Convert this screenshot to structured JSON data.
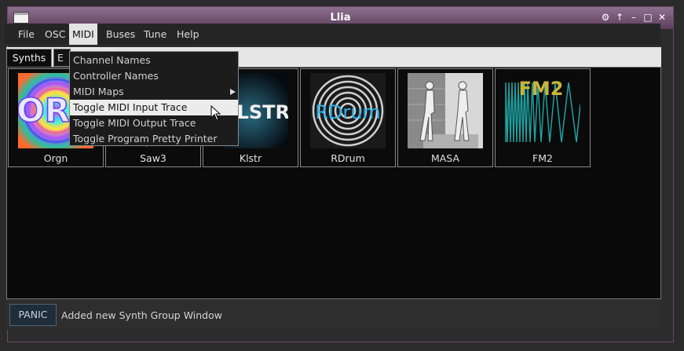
{
  "window": {
    "title": "Llia"
  },
  "menubar": {
    "items": [
      "File",
      "OSC",
      "MIDI",
      "Buses",
      "Tune",
      "Help"
    ]
  },
  "tabs": {
    "active": "Synths",
    "second_partial": "E"
  },
  "synths": [
    {
      "label": "Orgn",
      "logo_text": "ORG"
    },
    {
      "label": "Saw3"
    },
    {
      "label": "Klstr",
      "logo_text": "KLSTR"
    },
    {
      "label": "RDrum",
      "logo_text": "RDrum"
    },
    {
      "label": "MASA"
    },
    {
      "label": "FM2",
      "logo_text": "FM2"
    }
  ],
  "midi_menu": {
    "items": [
      "Channel Names",
      "Controller Names",
      "MIDI Maps",
      "Toggle MIDI Input Trace",
      "Toggle MIDI Output Trace",
      "Toggle Program Pretty Printer"
    ],
    "highlighted": "Toggle MIDI Input Trace"
  },
  "status": {
    "panic_label": "PANIC",
    "message": "Added new Synth Group Window"
  },
  "colors": {
    "title_bar": "#7a5a7a",
    "rdrum_text": "#2ab0e8",
    "fm2_text": "#c9b43a",
    "fm2_wave": "#1fa0a0"
  }
}
